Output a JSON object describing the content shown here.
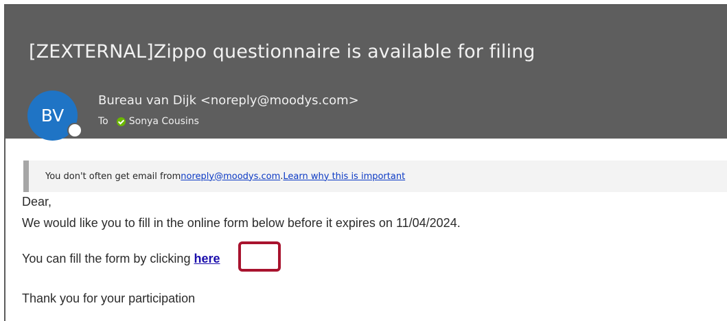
{
  "email": {
    "subject": "[ZEXTERNAL]Zippo questionnaire is available for filing",
    "avatar_initials": "BV",
    "sender": "Bureau van Dijk <noreply@moodys.com>",
    "to_label": "To",
    "recipient": "Sonya Cousins"
  },
  "notice": {
    "prefix": "You don't often get email from ",
    "sender_link": "noreply@moodys.com",
    "separator": ". ",
    "learn_link": "Learn why this is important"
  },
  "body": {
    "greeting": "Dear,",
    "line1": "We would like you to fill in the online form below before it expires on 11/04/2024.",
    "line2_prefix": "You can fill the form by clicking ",
    "link_text": "here",
    "closing": "Thank you for your participation"
  },
  "colors": {
    "header_bg": "#5e5e5e",
    "avatar_bg": "#1f74c5",
    "presence_ok": "#6bb700",
    "link": "#0b39c4",
    "highlight": "#a8132e"
  },
  "icons": {
    "presence": "presence-available-icon",
    "status_dot": "status-dot-icon"
  }
}
